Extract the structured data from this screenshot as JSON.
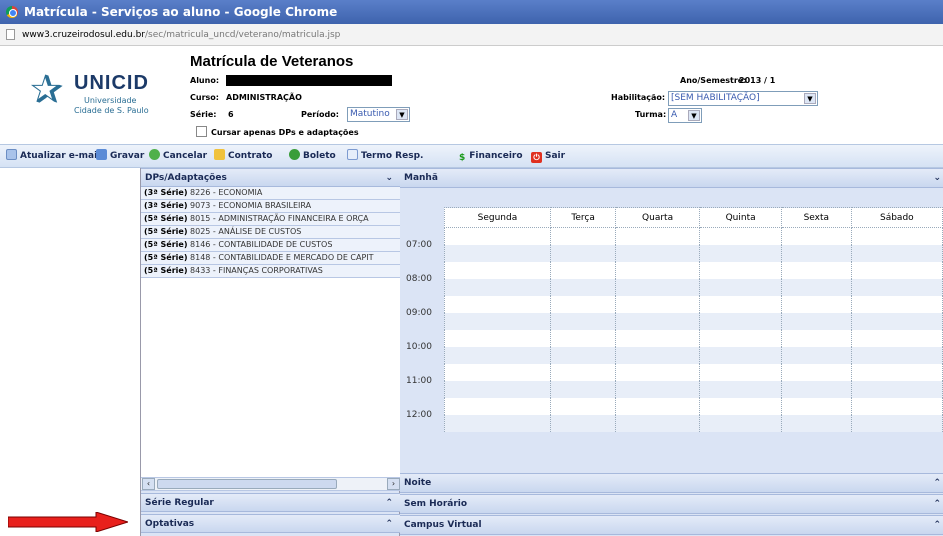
{
  "window": {
    "title": "Matrícula - Serviços ao aluno - Google Chrome"
  },
  "url": {
    "host": "www3.cruzeirodosul.edu.br",
    "path": "/sec/matricula_uncd/veterano/matricula.jsp"
  },
  "logo": {
    "brand": "UNICID",
    "line1": "Universidade",
    "line2": "Cidade de S. Paulo"
  },
  "header": {
    "title": "Matrícula de Veteranos",
    "aluno_label": "Aluno:",
    "curso_label": "Curso:",
    "curso_value": "ADMINISTRAÇÃO",
    "serie_label": "Série:",
    "serie_value": "6",
    "periodo_label": "Período:",
    "periodo_value": "Matutino",
    "cursar_label": "Cursar apenas DPs e adaptações",
    "ano_label": "Ano/Semestre:",
    "ano_value": "2013 / 1",
    "habilitacao_label": "Habilitação:",
    "habilitacao_value": "[SEM HABILITAÇÃO]",
    "turma_label": "Turma:",
    "turma_value": "A"
  },
  "toolbar": {
    "email": "Atualizar e-mail",
    "gravar": "Gravar",
    "cancelar": "Cancelar",
    "contrato": "Contrato",
    "boleto": "Boleto",
    "termo": "Termo Resp.",
    "financeiro": "Financeiro",
    "sair": "Sair"
  },
  "left": {
    "dps_header": "DPs/Adaptações",
    "dps": [
      {
        "serie": "(3ª Série)",
        "text": "8226 - ECONOMIA"
      },
      {
        "serie": "(3ª Série)",
        "text": "9073 - ECONOMIA BRASILEIRA"
      },
      {
        "serie": "(5ª Série)",
        "text": "8015 - ADMINISTRAÇÃO FINANCEIRA E ORÇA"
      },
      {
        "serie": "(5ª Série)",
        "text": "8025 - ANÁLISE DE CUSTOS"
      },
      {
        "serie": "(5ª Série)",
        "text": "8146 - CONTABILIDADE DE CUSTOS"
      },
      {
        "serie": "(5ª Série)",
        "text": "8148 - CONTABILIDADE E MERCADO DE CAPIT"
      },
      {
        "serie": "(5ª Série)",
        "text": "8433 - FINANÇAS CORPORATIVAS"
      }
    ],
    "serie_regular": "Série Regular",
    "optativas": "Optativas"
  },
  "right": {
    "manha": "Manhã",
    "days": [
      "Segunda",
      "Terça",
      "Quarta",
      "Quinta",
      "Sexta",
      "Sábado"
    ],
    "times": [
      "07:00",
      "08:00",
      "09:00",
      "10:00",
      "11:00",
      "12:00"
    ],
    "noite": "Noite",
    "sem_horario": "Sem Horário",
    "campus_virtual": "Campus Virtual"
  },
  "colors": {
    "accent": "#3e63ad",
    "panel": "#dbe4f5",
    "arrow": "#e8201c"
  }
}
